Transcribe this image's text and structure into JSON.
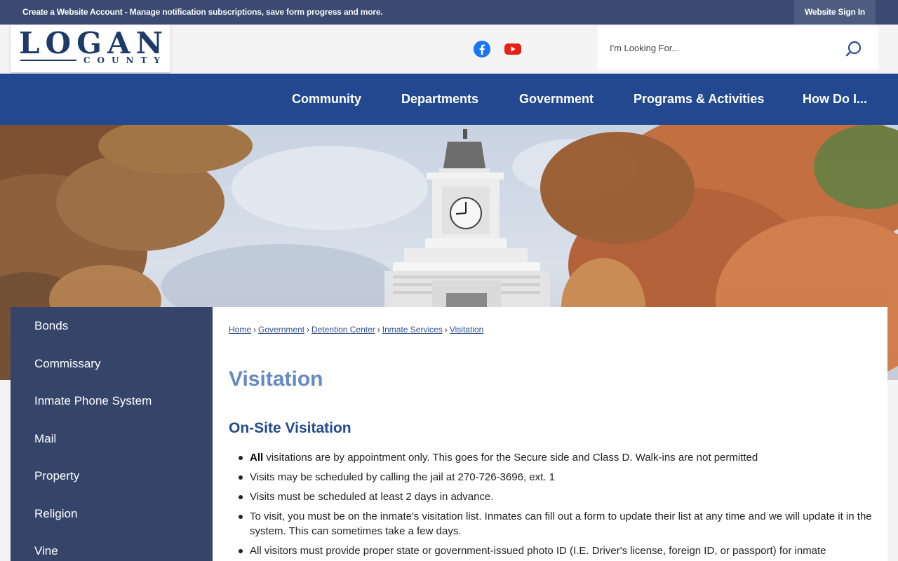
{
  "topbar": {
    "create_account_strong": "Create a Website Account",
    "create_account_rest": " - Manage notification subscriptions, save form progress and more.",
    "signin_label": "Website Sign In"
  },
  "logo": {
    "main_text": "LOGAN",
    "sub_text": "COUNTY"
  },
  "social": {
    "facebook_icon": "facebook-icon",
    "youtube_icon": "youtube-icon"
  },
  "search": {
    "placeholder": "I'm Looking For...",
    "icon": "search-icon"
  },
  "nav": {
    "items": [
      "Community",
      "Departments",
      "Government",
      "Programs & Activities",
      "How Do I..."
    ]
  },
  "sidebar": {
    "items": [
      "Bonds",
      "Commissary",
      "Inmate Phone System",
      "Mail",
      "Property",
      "Religion",
      "Vine"
    ]
  },
  "breadcrumb": [
    "Home",
    "Government",
    "Detention Center",
    "Inmate Services",
    "Visitation"
  ],
  "page_title": "Visitation",
  "section_title": "On-Site Visitation",
  "bullets": {
    "first_bold": "All",
    "first_rest": " visitations are by appointment only. This goes for the Secure side and Class D. Walk-ins are not permitted",
    "items": [
      "Visits may be scheduled by calling the jail at 270-726-3696, ext. 1",
      "Visits must be scheduled at least 2 days in advance.",
      "To visit, you must be on the inmate's visitation list. Inmates can fill out a form to update their list at any time and we will update it in the system. This can sometimes take a few days.",
      "All visitors must provide proper state or government-issued photo ID (I.E. Driver's license, foreign ID, or passport) for inmate"
    ]
  },
  "colors": {
    "topbar": "#3a4a70",
    "nav": "#22498f",
    "sidebar": "#354469",
    "title": "#6789c1",
    "section": "#234a8c"
  }
}
